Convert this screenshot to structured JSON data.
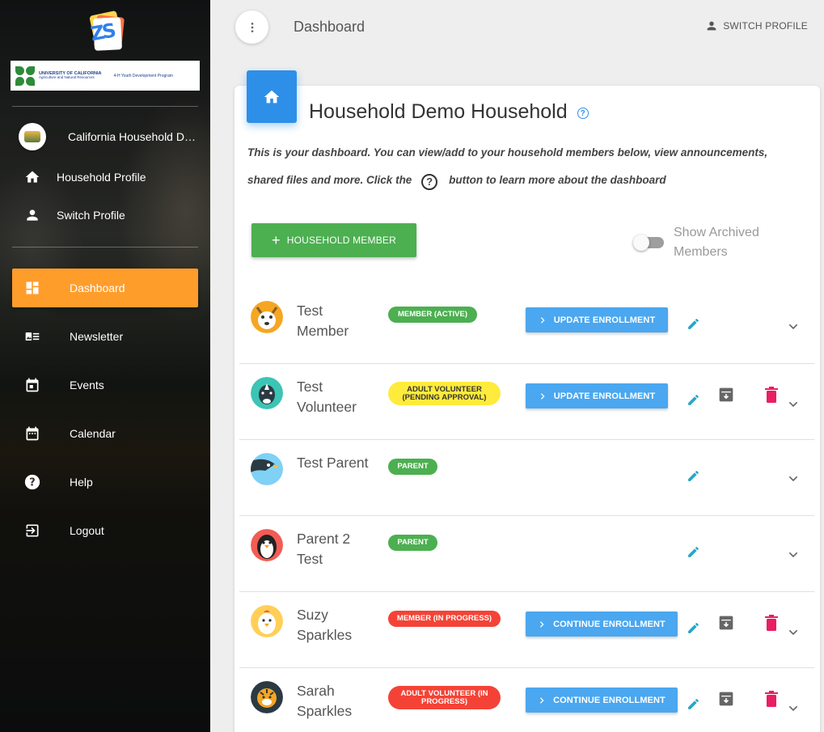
{
  "sidebar": {
    "logo_letters": "ZS",
    "uc_lines": [
      "UNIVERSITY OF CALIFORNIA",
      "Agriculture and Natural Resources",
      "4-H Youth Development Program"
    ],
    "profile_name": "California Household Demo",
    "profile_links": [
      {
        "label": "Household Profile",
        "icon": "home-icon"
      },
      {
        "label": "Switch Profile",
        "icon": "person-icon"
      }
    ],
    "nav": [
      {
        "label": "Dashboard",
        "icon": "dashboard-icon",
        "active": true
      },
      {
        "label": "Newsletter",
        "icon": "newsletter-icon"
      },
      {
        "label": "Events",
        "icon": "events-icon"
      },
      {
        "label": "Calendar",
        "icon": "calendar-icon"
      },
      {
        "label": "Help",
        "icon": "help-icon"
      },
      {
        "label": "Logout",
        "icon": "logout-icon"
      }
    ]
  },
  "topbar": {
    "title": "Dashboard",
    "switch_profile": "SWITCH PROFILE"
  },
  "card": {
    "title": "Household Demo Household",
    "intro_before": "This is your dashboard. You can view/add to your household members below, view announcements, shared files and more. Click the",
    "intro_after": "button to learn more about the dashboard",
    "add_member": "HOUSEHOLD MEMBER",
    "show_archived": "Show Archived Members"
  },
  "members": [
    {
      "name": "Test Member",
      "badge": "MEMBER (ACTIVE)",
      "badge_color": "#4caf50",
      "button": "UPDATE ENROLLMENT",
      "archive": false,
      "delete": false,
      "avatar": "deer"
    },
    {
      "name": "Test Volunteer",
      "badge": "ADULT VOLUNTEER (PENDING APPROVAL)",
      "badge_color": "#ffeb3b",
      "button": "UPDATE ENROLLMENT",
      "archive": true,
      "delete": true,
      "avatar": "rhino"
    },
    {
      "name": "Test Parent",
      "badge": "PARENT",
      "badge_color": "#4caf50",
      "button": "",
      "archive": false,
      "delete": false,
      "avatar": "bird"
    },
    {
      "name": "Parent 2 Test",
      "badge": "PARENT",
      "badge_color": "#4caf50",
      "button": "",
      "archive": false,
      "delete": false,
      "avatar": "penguin"
    },
    {
      "name": "Suzy Sparkles",
      "badge": "MEMBER (IN PROGRESS)",
      "badge_color": "#f44336",
      "button": "CONTINUE ENROLLMENT",
      "archive": true,
      "delete": true,
      "avatar": "chicken"
    },
    {
      "name": "Sarah Sparkles",
      "badge": "ADULT VOLUNTEER (IN PROGRESS)",
      "badge_color": "#f44336",
      "button": "CONTINUE ENROLLMENT",
      "archive": true,
      "delete": true,
      "avatar": "tiger"
    }
  ]
}
